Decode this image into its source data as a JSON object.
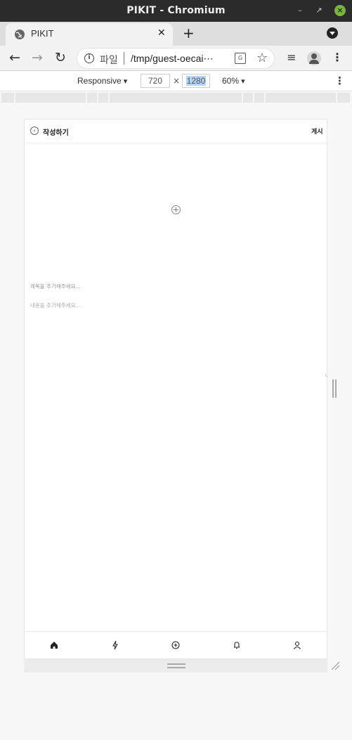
{
  "window": {
    "title": "PIKIT - Chromium"
  },
  "tab": {
    "title": "PIKIT"
  },
  "omnibox": {
    "label": "파일",
    "url": "/tmp/guest-oecai⋯"
  },
  "devtools": {
    "mode": "Responsive",
    "width": "720",
    "times": "×",
    "height": "1280",
    "zoom": "60%"
  },
  "app": {
    "header": {
      "title": "작성하기",
      "post": "게시"
    },
    "form": {
      "title_placeholder": "제목을 추가해주세요...",
      "content_placeholder": "내용을 추가해주세요..."
    }
  },
  "icons": {
    "back": "←",
    "forward": "→",
    "reload": "↻",
    "star": "☆",
    "media": "≡",
    "kebab": "⋮",
    "minimize": "–",
    "maximize": "⤢",
    "close": "✕",
    "newtab": "+",
    "info": "i",
    "translate": "G",
    "chevron_left": "‹",
    "home": "⌂",
    "flash": "ϟ",
    "add": "⊕",
    "bell": "⍾",
    "user": "♀"
  },
  "accent": "#7cb342"
}
